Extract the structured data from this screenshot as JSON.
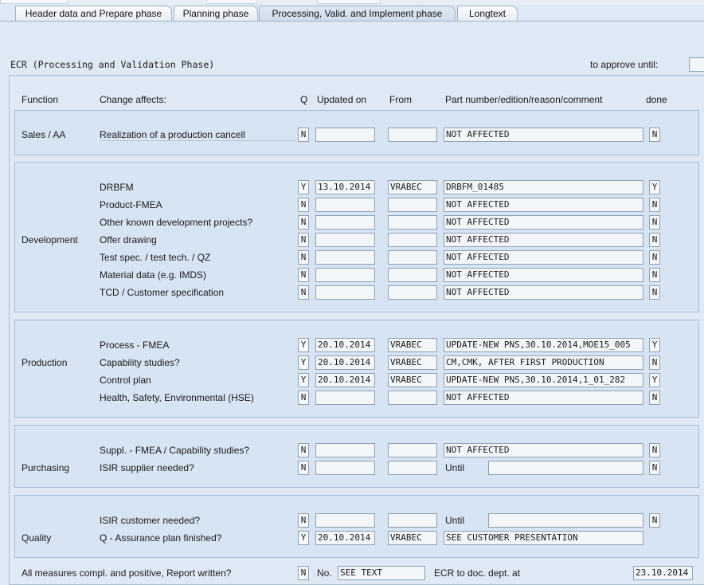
{
  "tabs": [
    {
      "label": "Header data and Prepare phase"
    },
    {
      "label": "Planning phase"
    },
    {
      "label": "Processing, Valid. and Implement phase"
    },
    {
      "label": "Longtext"
    }
  ],
  "ecr_title": "ECR (Processing and Validation Phase)",
  "approve_until_label": "to approve until:",
  "approve_until_value": "",
  "headers": {
    "function": "Function",
    "change_affects": "Change affects:",
    "q": "Q",
    "updated_on": "Updated on",
    "from": "From",
    "comment": "Part number/edition/reason/comment",
    "done": "done"
  },
  "sales": {
    "function": "Sales / AA",
    "rows": [
      {
        "label": "Realization of a production cancell",
        "q": "N",
        "date": "",
        "from": "",
        "comment": "NOT AFFECTED",
        "done": "N"
      }
    ]
  },
  "development": {
    "function": "Development",
    "rows": [
      {
        "label": "DRBFM",
        "q": "Y",
        "date": "13.10.2014",
        "from": "VRABEC",
        "comment": "DRBFM_01485",
        "done": "Y"
      },
      {
        "label": "Product-FMEA",
        "q": "N",
        "date": "",
        "from": "",
        "comment": "NOT AFFECTED",
        "done": "N"
      },
      {
        "label": "Other known development projects?",
        "q": "N",
        "date": "",
        "from": "",
        "comment": "NOT AFFECTED",
        "done": "N"
      },
      {
        "label": "Offer drawing",
        "q": "N",
        "date": "",
        "from": "",
        "comment": "NOT AFFECTED",
        "done": "N"
      },
      {
        "label": "Test spec. / test tech. / QZ",
        "q": "N",
        "date": "",
        "from": "",
        "comment": "NOT AFFECTED",
        "done": "N"
      },
      {
        "label": "Material data (e.g. IMDS)",
        "q": "N",
        "date": "",
        "from": "",
        "comment": "NOT AFFECTED",
        "done": "N"
      },
      {
        "label": "TCD / Customer specification",
        "q": "N",
        "date": "",
        "from": "",
        "comment": "NOT AFFECTED",
        "done": "N"
      }
    ]
  },
  "production": {
    "function": "Production",
    "rows": [
      {
        "label": "Process - FMEA",
        "q": "Y",
        "date": "20.10.2014",
        "from": "VRABEC",
        "comment": "UPDATE-NEW PNS,30.10.2014,MOE15_005",
        "done": "Y"
      },
      {
        "label": "Capability studies?",
        "q": "Y",
        "date": "20.10.2014",
        "from": "VRABEC",
        "comment": "CM,CMK, AFTER FIRST PRODUCTION",
        "done": "N"
      },
      {
        "label": "Control plan",
        "q": "Y",
        "date": "20.10.2014",
        "from": "VRABEC",
        "comment": "UPDATE-NEW PNS,30.10.2014,1_01_282",
        "done": "Y"
      },
      {
        "label": "Health, Safety, Environmental (HSE)",
        "q": "N",
        "date": "",
        "from": "",
        "comment": "NOT AFFECTED",
        "done": "N"
      }
    ]
  },
  "purchasing": {
    "function": "Purchasing",
    "row1": {
      "label": "Suppl. - FMEA / Capability studies?",
      "q": "N",
      "date": "",
      "from": "",
      "comment": "NOT AFFECTED",
      "done": "N"
    },
    "row2": {
      "label": "ISIR supplier needed?",
      "q": "N",
      "date": "",
      "from": "",
      "until_label": "Until",
      "until_value": "",
      "done": "N"
    }
  },
  "quality": {
    "function": "Quality",
    "row1": {
      "label": "ISIR customer needed?",
      "q": "N",
      "date": "",
      "from": "",
      "until_label": "Until",
      "until_value": "",
      "done": "N"
    },
    "row2": {
      "label": "Q - Assurance plan finished?",
      "q": "Y",
      "date": "20.10.2014",
      "from": "VRABEC",
      "comment": "SEE CUSTOMER PRESENTATION"
    }
  },
  "footer": {
    "label": "All measures compl. and positive, Report written?",
    "check": "N",
    "no_label": "No.",
    "no_value": "SEE TEXT",
    "doc_label": "ECR to doc. dept. at",
    "doc_date": "23.10.2014"
  }
}
